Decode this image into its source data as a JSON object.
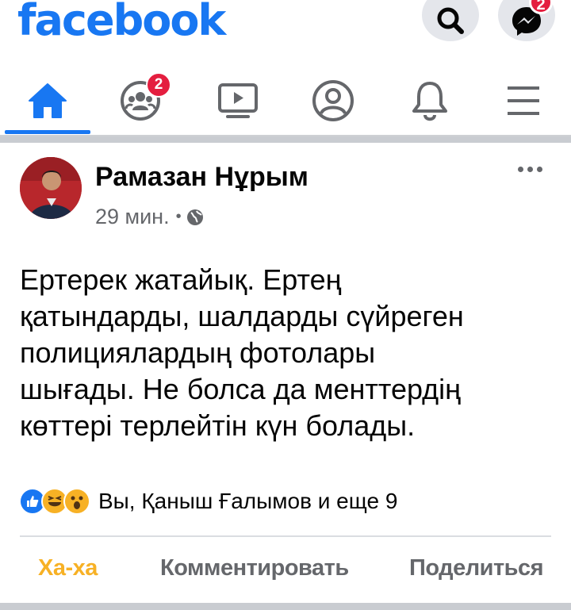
{
  "header": {
    "logo_text": "facebook",
    "messenger_badge": "2",
    "icons": [
      "search-icon",
      "messenger-icon"
    ]
  },
  "tabs": [
    {
      "name": "home",
      "icon": "home-icon",
      "active": true
    },
    {
      "name": "groups",
      "icon": "groups-icon",
      "badge": "2"
    },
    {
      "name": "watch",
      "icon": "video-icon"
    },
    {
      "name": "profile",
      "icon": "profile-icon"
    },
    {
      "name": "notifications",
      "icon": "bell-icon"
    },
    {
      "name": "menu",
      "icon": "menu-icon"
    }
  ],
  "post": {
    "author": "Рамазан Нұрым",
    "time": "29 мин.",
    "privacy_icon": "globe-icon",
    "text": "Ертерек жатайық. Ертең\nқатындарды, шалдарды сүйреген\nполициялардың фотолары\nшығады.  Не болса да менттердің\nкөттері терлейтін күн болады.",
    "reactions": {
      "icons": [
        "like-icon",
        "haha-icon",
        "wow-icon"
      ],
      "summary": "Вы, Қаныш Ғалымов и еще 9"
    },
    "actions": {
      "haha": "Ха-ха",
      "comment": "Комментировать",
      "share": "Поделиться"
    }
  },
  "colors": {
    "brand": "#1877f2",
    "badge": "#e41e3f",
    "haha": "#f7b125",
    "secondary_text": "#65676b"
  }
}
